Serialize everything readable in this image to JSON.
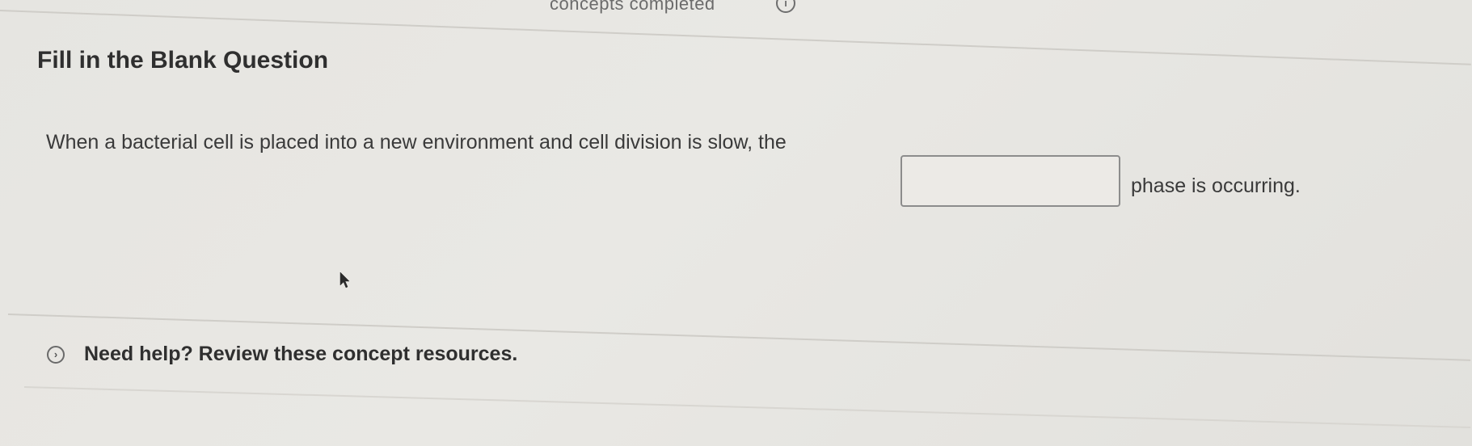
{
  "header": {
    "progress_text": "concepts completed",
    "info_icon_label": "i"
  },
  "question": {
    "type_title": "Fill in the Blank Question",
    "text_before": "When a bacterial cell is placed into a new environment and cell division is slow, the",
    "blank": {
      "value": "",
      "placeholder": ""
    },
    "text_after": "phase is occurring."
  },
  "help": {
    "chevron_glyph": "›",
    "label": "Need help? Review these concept resources."
  },
  "icons": {
    "info": "info-icon",
    "chevron": "chevron-right-circle-icon",
    "cursor": "mouse-pointer-icon"
  }
}
